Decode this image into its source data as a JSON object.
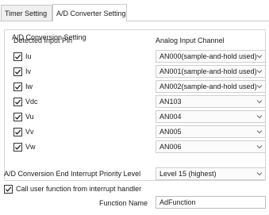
{
  "tabs": [
    {
      "label": "Timer Setting",
      "active": false
    },
    {
      "label": "A/D Converter Setting",
      "active": true
    }
  ],
  "group": {
    "title": "A/D Conversion Setting",
    "col_pin": "Detected Input Pin",
    "col_channel": "Analog Input Channel"
  },
  "rows": [
    {
      "pin": "Iu",
      "checked": true,
      "channel": "AN000(sample-and-hold used)"
    },
    {
      "pin": "Iv",
      "checked": true,
      "channel": "AN001(sample-and-hold used)"
    },
    {
      "pin": "Iw",
      "checked": true,
      "channel": "AN002(sample-and-hold used)"
    },
    {
      "pin": "Vdc",
      "checked": true,
      "channel": "AN103"
    },
    {
      "pin": "Vu",
      "checked": true,
      "channel": "AN004"
    },
    {
      "pin": "Vv",
      "checked": true,
      "channel": "AN005"
    },
    {
      "pin": "Vw",
      "checked": true,
      "channel": "AN006"
    }
  ],
  "interrupt": {
    "label": "A/D Conversion End Interrupt Priority Level",
    "value": "Level 15 (highest)"
  },
  "callback": {
    "checkbox_label": "Call user function from interrupt handler",
    "checked": true,
    "function_name_label": "Function Name",
    "function_name_value": "AdFunction"
  },
  "icons": {
    "check": "check-icon",
    "dropdown": "chevron-down-icon"
  }
}
